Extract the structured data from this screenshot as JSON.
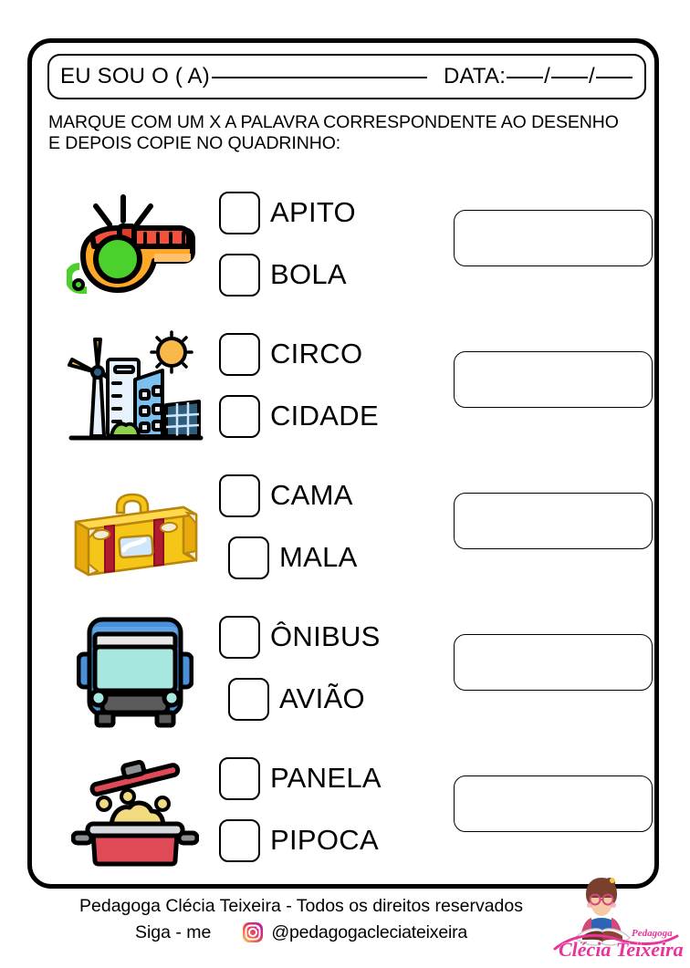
{
  "header": {
    "name_label": "EU SOU O ( A)",
    "date_label": "DATA:",
    "date_sep": "/"
  },
  "instructions": {
    "line1": "MARQUE COM UM  X  A PALAVRA   CORRESPONDENTE AO DESENHO",
    "line2": "E DEPOIS COPIE NO QUADRINHO:"
  },
  "exercises": [
    {
      "picture": "whistle-icon",
      "options": [
        {
          "label": "APITO",
          "checked": false
        },
        {
          "label": "BOLA",
          "checked": false
        }
      ]
    },
    {
      "picture": "city-icon",
      "options": [
        {
          "label": "CIRCO",
          "checked": false
        },
        {
          "label": "CIDADE",
          "checked": false
        }
      ]
    },
    {
      "picture": "suitcase-icon",
      "options": [
        {
          "label": "CAMA",
          "checked": false
        },
        {
          "label": "MALA",
          "checked": false
        }
      ]
    },
    {
      "picture": "bus-icon",
      "options": [
        {
          "label": "ÔNIBUS",
          "checked": false
        },
        {
          "label": "AVIÃO",
          "checked": false
        }
      ]
    },
    {
      "picture": "pot-icon",
      "options": [
        {
          "label": "PANELA",
          "checked": false
        },
        {
          "label": "PIPOCA",
          "checked": false
        }
      ]
    }
  ],
  "footer": {
    "copyright": "Pedagoga Clécia Teixeira - Todos os direitos reservados",
    "follow_label": "Siga - me",
    "instagram_handle": "@pedagogacleciateixeira",
    "logo_name_small": "Pedagoga",
    "logo_name_main": "Clécia Teixeira"
  },
  "colors": {
    "ink": "#000000",
    "whistle_red": "#f4503c",
    "whistle_orange": "#ffa726",
    "whistle_green": "#4cd02c",
    "city_blue": "#7cc0f0",
    "city_light_blue": "#cfe6fb",
    "city_sun": "#f9b949",
    "city_green": "#8fd14f",
    "city_panel": "#2e5c7a",
    "suitcase_yellow": "#f5c518",
    "suitcase_strap": "#b01b2e",
    "bus_blue": "#4a90d9",
    "bus_window": "#a8e6e0",
    "bus_gray": "#5a5a5a",
    "pot_red": "#e04a56",
    "pot_gray": "#b7bcc2",
    "popcorn_yellow": "#f2da7e",
    "logo_pink": "#e8339a"
  }
}
